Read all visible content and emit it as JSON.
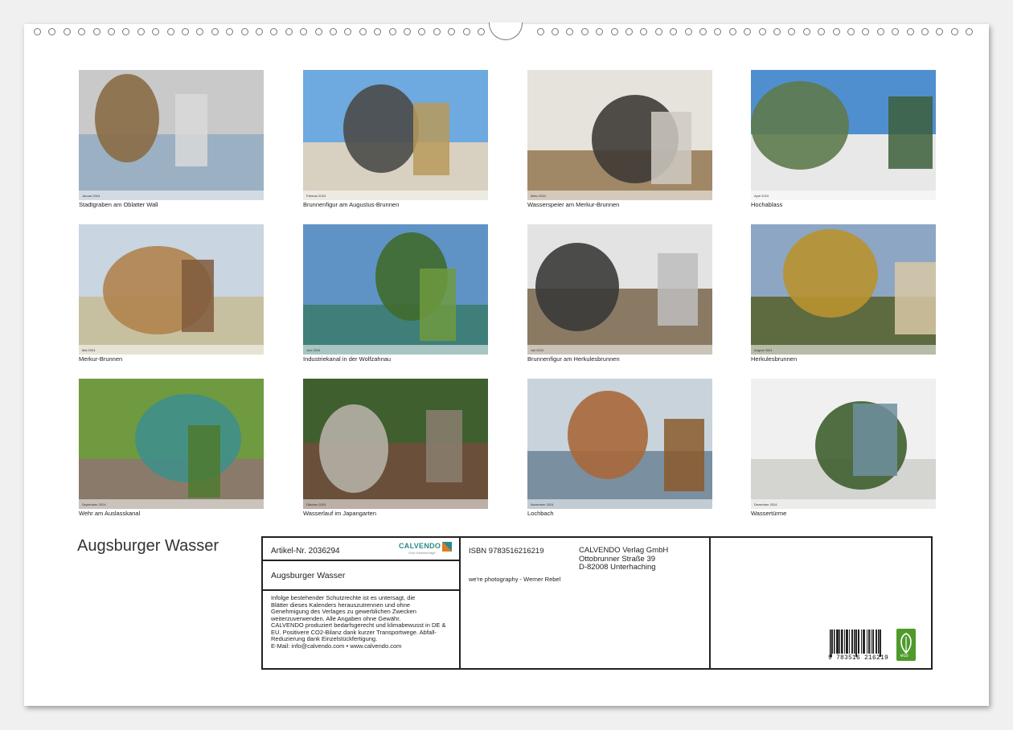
{
  "calendar": {
    "title": "Augsburger Wasser",
    "thumbnails": [
      {
        "caption": "Stadtgraben am Oblatter Wall",
        "month": "Januar 2024",
        "palette": [
          "#c9c9c9",
          "#8a6b45",
          "#9bb0c2",
          "#d9d9d9"
        ]
      },
      {
        "caption": "Brunnenfigur am Augustus-Brunnen",
        "month": "Februar 2024",
        "palette": [
          "#6ea9df",
          "#4a4a48",
          "#d8d0c0",
          "#b89a5a"
        ]
      },
      {
        "caption": "Wasserspeier am Merkur-Brunnen",
        "month": "März 2024",
        "palette": [
          "#e6e2dc",
          "#3e3b36",
          "#a08866",
          "#cfcac2"
        ]
      },
      {
        "caption": "Hochablass",
        "month": "April 2024",
        "palette": [
          "#4f8fd0",
          "#5d7a4d",
          "#e8e8e8",
          "#3b5f3a"
        ]
      },
      {
        "caption": "Merkur-Brunnen",
        "month": "Mai 2024",
        "palette": [
          "#c9d5e0",
          "#b0834e",
          "#c7c0a0",
          "#7f5a3c"
        ]
      },
      {
        "caption": "Industriekanal in der Wolfzahnau",
        "month": "Juni 2024",
        "palette": [
          "#5f93c6",
          "#3f6b2b",
          "#3f7f7a",
          "#6e9a40"
        ]
      },
      {
        "caption": "Brunnenfigur am Herkulesbrunnen",
        "month": "Juli 2024",
        "palette": [
          "#e3e3e3",
          "#3a3a38",
          "#8b7a63",
          "#bdbdbd"
        ]
      },
      {
        "caption": "Herkulesbrunnen",
        "month": "August 2024",
        "palette": [
          "#8da6c4",
          "#b8932f",
          "#5e6a3f",
          "#d8c7a6"
        ]
      },
      {
        "caption": "Wehr am Auslasskanal",
        "month": "September 2024",
        "palette": [
          "#6f9a3f",
          "#3f8f8a",
          "#8a7a6a",
          "#4f7a2f"
        ]
      },
      {
        "caption": "Wasserlauf im Japangarten",
        "month": "Oktober 2024",
        "palette": [
          "#3f5f2f",
          "#b5b0a6",
          "#6a4f3a",
          "#8a7f70"
        ]
      },
      {
        "caption": "Lochbach",
        "month": "November 2024",
        "palette": [
          "#c9d3dc",
          "#a8683a",
          "#7a8fa0",
          "#8a5a2a"
        ]
      },
      {
        "caption": "Wassertürme",
        "month": "Dezember 2024",
        "palette": [
          "#f0f0f0",
          "#3f5f2f",
          "#d4d4d0",
          "#6f8f9f"
        ]
      }
    ]
  },
  "imprint": {
    "article_label": "Artikel-Nr. 2036294",
    "brand": "CALVENDO",
    "brand_sub": "Gute Kalendertage",
    "product_title": "Augsburger Wasser",
    "legal_lines": [
      "Infolge bestehender Schutzrechte ist es untersagt, die",
      "Blätter dieses Kalenders herauszutrennen und ohne",
      "Genehmigung des Verlages zu gewerblichen Zwecken",
      "weiterzuverwenden. Alle Angaben ohne Gewähr.",
      "CALVENDO produziert bedarfsgerecht und klimabewusst in DE &",
      "EU. Positivere CO2-Bilanz dank kurzer Transportwege. Abfall-",
      "Reduzierung dank Einzelstückfertigung.",
      "E-Mail: info@calvendo.com • www.calvendo.com"
    ],
    "isbn": "ISBN 9783516216219",
    "photographer": "we're photography - Werner Rebel",
    "publisher_lines": [
      "CALVENDO Verlag GmbH",
      "Ottobrunner Straße 39",
      "D-82008 Unterhaching"
    ],
    "barcode_number": "9  783516  216219",
    "eco_label": "eco"
  },
  "colors": {
    "background": "#f0f0f0",
    "page": "#ffffff",
    "eco_green": "#4e9a2a",
    "brand_teal": "#2a8a8a",
    "brand_orange": "#e07a1f"
  }
}
